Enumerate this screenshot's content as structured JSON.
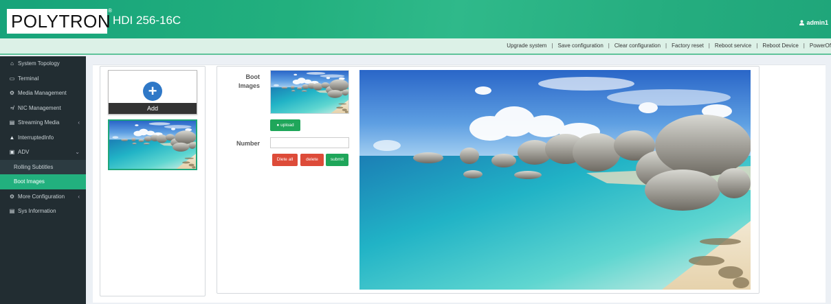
{
  "header": {
    "logo_text": "POLYTRON",
    "registered_mark": "®",
    "model": "HDI 256-16C",
    "user": "admin1"
  },
  "top_menu": [
    "Upgrade system",
    "Save configuration",
    "Clear configuration",
    "Factory reset",
    "Reboot service",
    "Reboot Device",
    "PowerOf"
  ],
  "sidebar": {
    "items": [
      {
        "label": "System Topology",
        "icon": "home-icon"
      },
      {
        "label": "Terminal",
        "icon": "monitor-icon"
      },
      {
        "label": "Media Management",
        "icon": "gear-icon"
      },
      {
        "label": "NIC Management",
        "icon": "rss-icon"
      },
      {
        "label": "Streaming Media",
        "icon": "film-icon"
      },
      {
        "label": "InterruptedInfo",
        "icon": "bell-icon"
      },
      {
        "label": "ADV",
        "icon": "list-icon"
      },
      {
        "label": "More Configuration",
        "icon": "cogs-icon"
      },
      {
        "label": "Sys Information",
        "icon": "table-icon"
      }
    ],
    "subitems": [
      "Rolling Subtitles",
      "Boot Images"
    ],
    "active": "Boot Images"
  },
  "left_panel": {
    "add_label": "Add"
  },
  "form": {
    "boot_label": "Boot Images",
    "upload_label": "upload",
    "number_label": "Number",
    "number_value": "",
    "delete_all_label": "Dlete all",
    "delete_label": "delete",
    "submit_label": "submit"
  },
  "colors": {
    "brand_green": "#22b07e",
    "sidebar_bg": "#222d32",
    "danger": "#dd4b39",
    "success": "#1fa65a",
    "primary": "#2f78c7"
  }
}
